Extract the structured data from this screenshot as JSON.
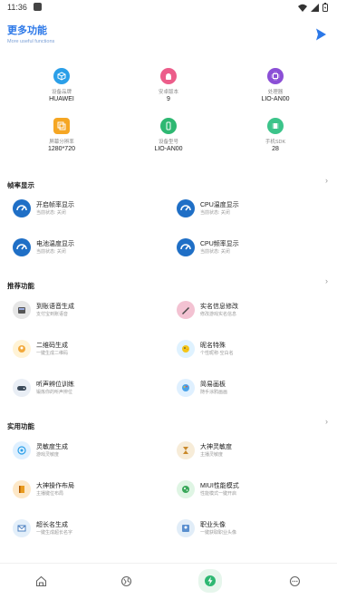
{
  "status_bar": {
    "time": "11:36"
  },
  "header": {
    "title": "更多功能",
    "subtitle": "More useful functions"
  },
  "device_info": [
    {
      "label": "设备品牌",
      "value": "HUAWEI",
      "icon": "cube-icon",
      "color": "#2b9fe8"
    },
    {
      "label": "安卓版本",
      "value": "9",
      "icon": "android-icon",
      "color": "#ec5d8a"
    },
    {
      "label": "处理器",
      "value": "LIO-AN00",
      "icon": "cpu-icon",
      "color": "#8b4fd6"
    },
    {
      "label": "屏幕分辨率",
      "value": "1280*720",
      "icon": "screen-icon",
      "color": "#f5a623"
    },
    {
      "label": "设备型号",
      "value": "LIO-AN00",
      "icon": "phone-icon",
      "color": "#2eb872"
    },
    {
      "label": "手机SDK",
      "value": "28",
      "icon": "chip-icon",
      "color": "#3cc48a"
    }
  ],
  "sections": [
    {
      "title": "帧率显示",
      "items": [
        {
          "title": "开启帧率显示",
          "subtitle": "当前状态: 关闭",
          "icon": "gauge-icon"
        },
        {
          "title": "CPU温度显示",
          "subtitle": "当前状态: 关闭",
          "icon": "gauge-icon"
        },
        {
          "title": "电池温度显示",
          "subtitle": "当前状态: 关闭",
          "icon": "gauge-icon"
        },
        {
          "title": "CPU频率显示",
          "subtitle": "当前状态: 关闭",
          "icon": "gauge-icon"
        }
      ]
    },
    {
      "title": "推荐功能",
      "items": [
        {
          "title": "到账语音生成",
          "subtitle": "支付宝到账语音",
          "icon": "speaker-icon"
        },
        {
          "title": "实名信息修改",
          "subtitle": "修改游戏实名信息",
          "icon": "pen-icon"
        },
        {
          "title": "二维码生成",
          "subtitle": "一键生成二维码",
          "icon": "qrcode-icon"
        },
        {
          "title": "昵名特殊",
          "subtitle": "个性昵称·空白名",
          "icon": "chick-icon"
        },
        {
          "title": "听声辨位训练",
          "subtitle": "锻炼你的听声辨位",
          "icon": "gamepad-icon"
        },
        {
          "title": "简易画板",
          "subtitle": "随手涂鸦画画",
          "icon": "palette-icon"
        }
      ]
    },
    {
      "title": "实用功能",
      "items": [
        {
          "title": "灵敏度生成",
          "subtitle": "游戏灵敏度",
          "icon": "target-icon"
        },
        {
          "title": "大神灵敏度",
          "subtitle": "主播灵敏度",
          "icon": "hourglass-icon"
        },
        {
          "title": "大神操作布局",
          "subtitle": "主播键位布局",
          "icon": "book-icon"
        },
        {
          "title": "MIUI性能模式",
          "subtitle": "性能模式一键开启",
          "icon": "shield-icon"
        },
        {
          "title": "超长名生成",
          "subtitle": "一键生成超长名字",
          "icon": "letter-icon"
        },
        {
          "title": "职业头像",
          "subtitle": "一键获取职业头像",
          "icon": "avatar-icon"
        }
      ]
    }
  ],
  "bottom_nav": [
    {
      "name": "home",
      "icon": "home-icon"
    },
    {
      "name": "discover",
      "icon": "globe-icon"
    },
    {
      "name": "tools",
      "icon": "bolt-icon"
    },
    {
      "name": "more",
      "icon": "more-icon"
    }
  ],
  "colors": {
    "accent": "#2c78e8",
    "nav_active": "#2eb872"
  }
}
